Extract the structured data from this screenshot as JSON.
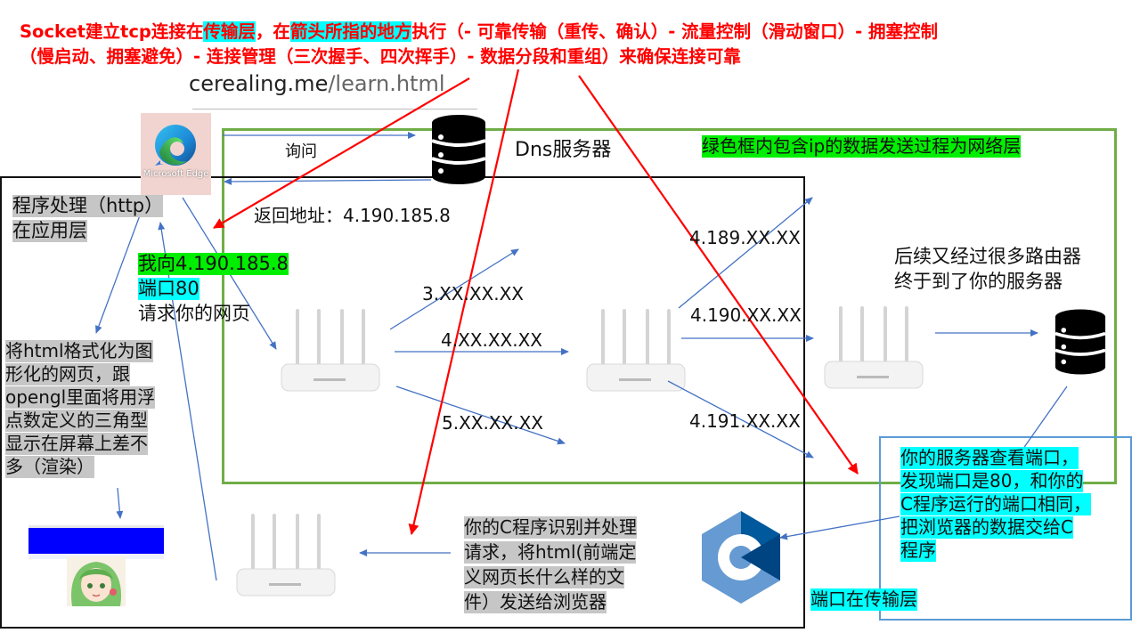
{
  "title": {
    "seg1": "Socket建立tcp连接在",
    "seg2": "传输层",
    "seg3": "，在",
    "seg4": "箭头所指的地方",
    "seg5": "执行（- 可靠传输（重传、确认）- 流量控制（滑动窗口）- 拥塞控制",
    "line2": "（慢启动、拥塞避免）- 连接管理（三次握手、四次挥手）- 数据分段和重组）来确保连接可靠"
  },
  "url": {
    "domain": "cerealing.me",
    "path": "/learn.html"
  },
  "edge_label": "Microsoft Edge",
  "dns": {
    "query_label": "询问",
    "server_label": "Dns服务器",
    "return_label": "返回地址：4.190.185.8"
  },
  "green_note": "绿色框内包含ip的数据发送过程为网络层",
  "app_layer": {
    "line1": "程序处理（http）",
    "line2": "在应用层"
  },
  "request": {
    "line1": "我向4.190.185.8",
    "line2": "端口80",
    "line3": "请求你的网页"
  },
  "render_note": [
    "将html格式化为图",
    "形化的网页，跟",
    "opengl里面将用浮",
    "点数定义的三角型",
    "显示在屏幕上差不",
    "多（渲染）"
  ],
  "ips": {
    "a": "3.XX.XX.XX",
    "b": "4.XX.XX.XX",
    "c": "5.XX.XX.XX",
    "d": "4.189.XX.XX",
    "e": "4.190.XX.XX",
    "f": "4.191.XX.XX"
  },
  "later_routers": {
    "line1": "后续又经过很多路由器",
    "line2": "终于到了你的服务器"
  },
  "server_port": [
    "你的服务器查看端口，",
    "发现端口是80，和你的",
    "C程序运行的端口相同，",
    "把浏览器的数据交给C",
    "程序"
  ],
  "port_layer": "端口在传输层",
  "c_program": [
    "你的C程序识别并处理",
    "请求，将html(前端定",
    "义网页长什么样的文",
    "件）发送给浏览器"
  ],
  "colors": {
    "red": "#ff0000",
    "blue": "#4472c4",
    "green": "#70ad47",
    "cyan": "#00ffff",
    "lime": "#00ee00",
    "gray": "#c6c6c6"
  }
}
